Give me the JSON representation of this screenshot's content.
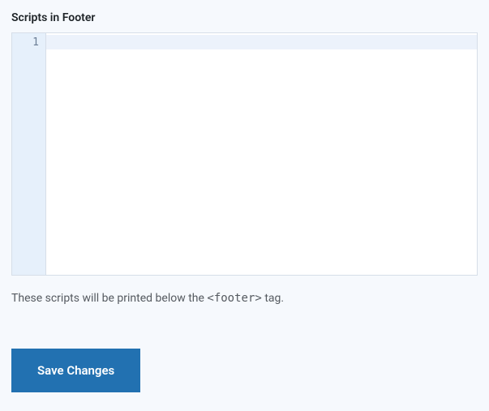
{
  "field": {
    "label": "Scripts in Footer",
    "gutter_line": "1",
    "value": ""
  },
  "description": {
    "before_tag": "These scripts will be printed below the ",
    "tag": "<footer>",
    "after_tag": " tag."
  },
  "actions": {
    "save_label": "Save Changes"
  }
}
